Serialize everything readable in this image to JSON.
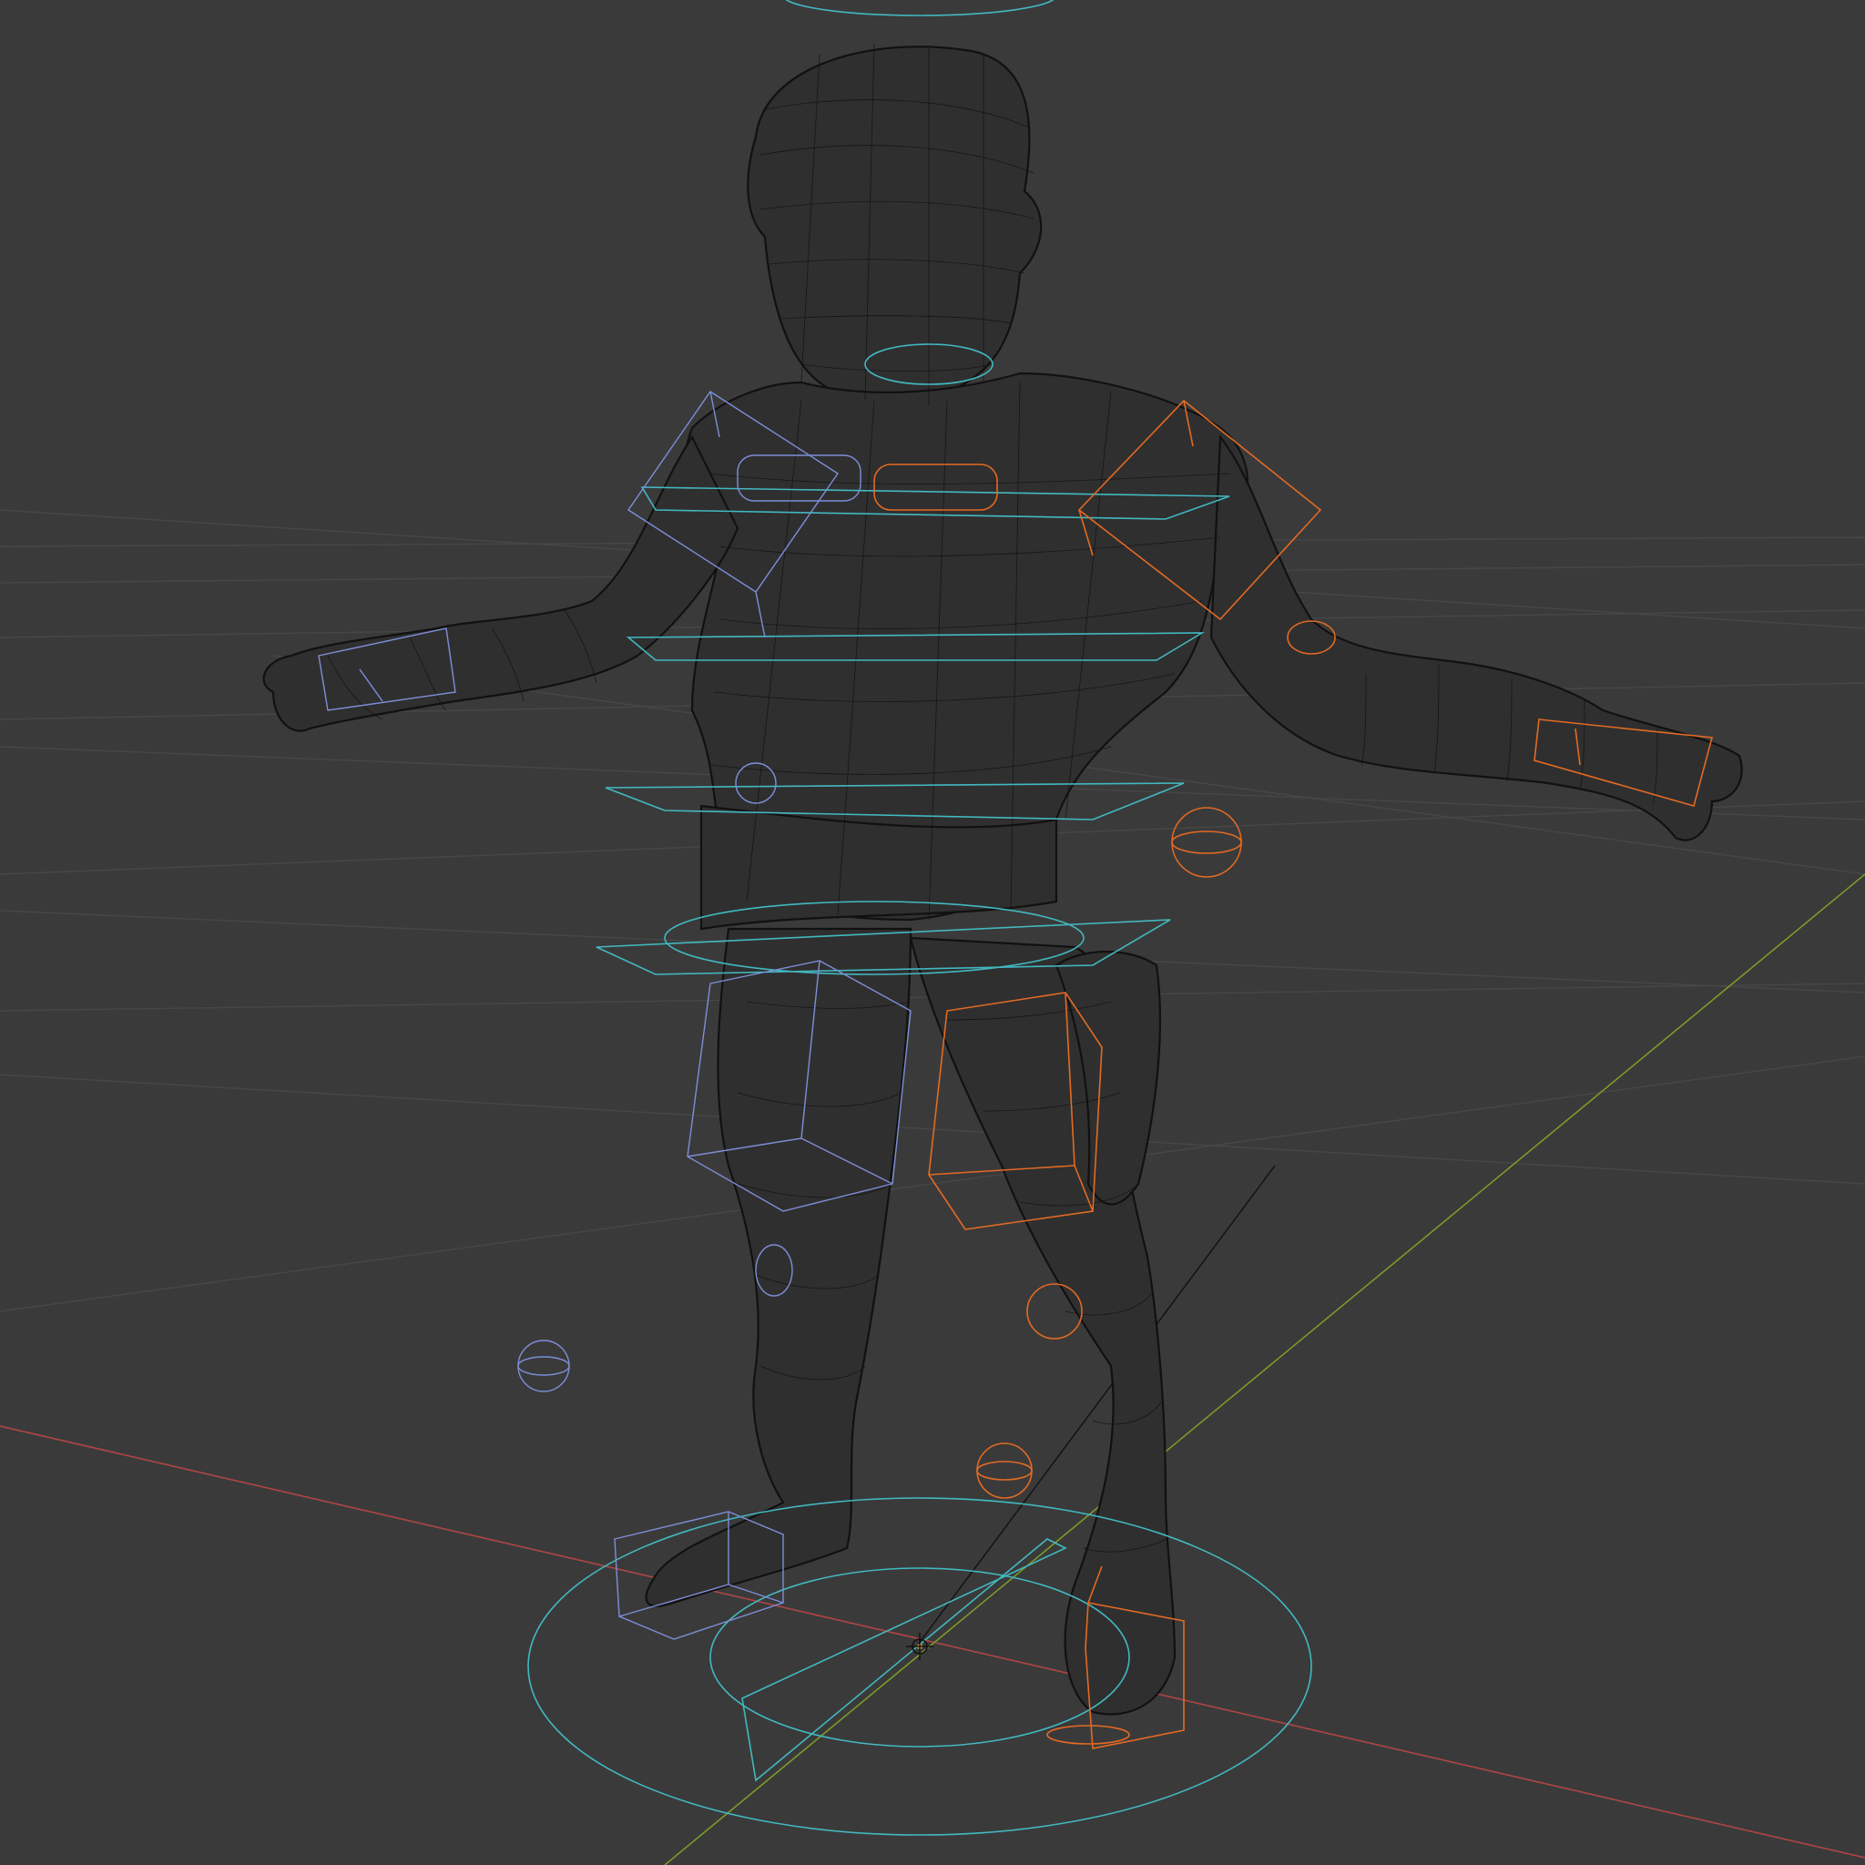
{
  "viewport": {
    "background_color": "#3a3a3a",
    "grid_color": "#474747",
    "mesh_wire_color": "#0d0d0d",
    "axis_x_color": "#b04545",
    "axis_y_color": "#7a9a2a"
  },
  "rig": {
    "controls": [
      {
        "name": "root-circle",
        "color": "#42b8c0"
      },
      {
        "name": "torso-rings",
        "color": "#42b8c0"
      },
      {
        "name": "left-limb-controls",
        "color": "#7e8ed8"
      },
      {
        "name": "right-limb-controls",
        "color": "#e36a24"
      }
    ]
  },
  "icons": {
    "origin": "3d-cursor-icon"
  }
}
